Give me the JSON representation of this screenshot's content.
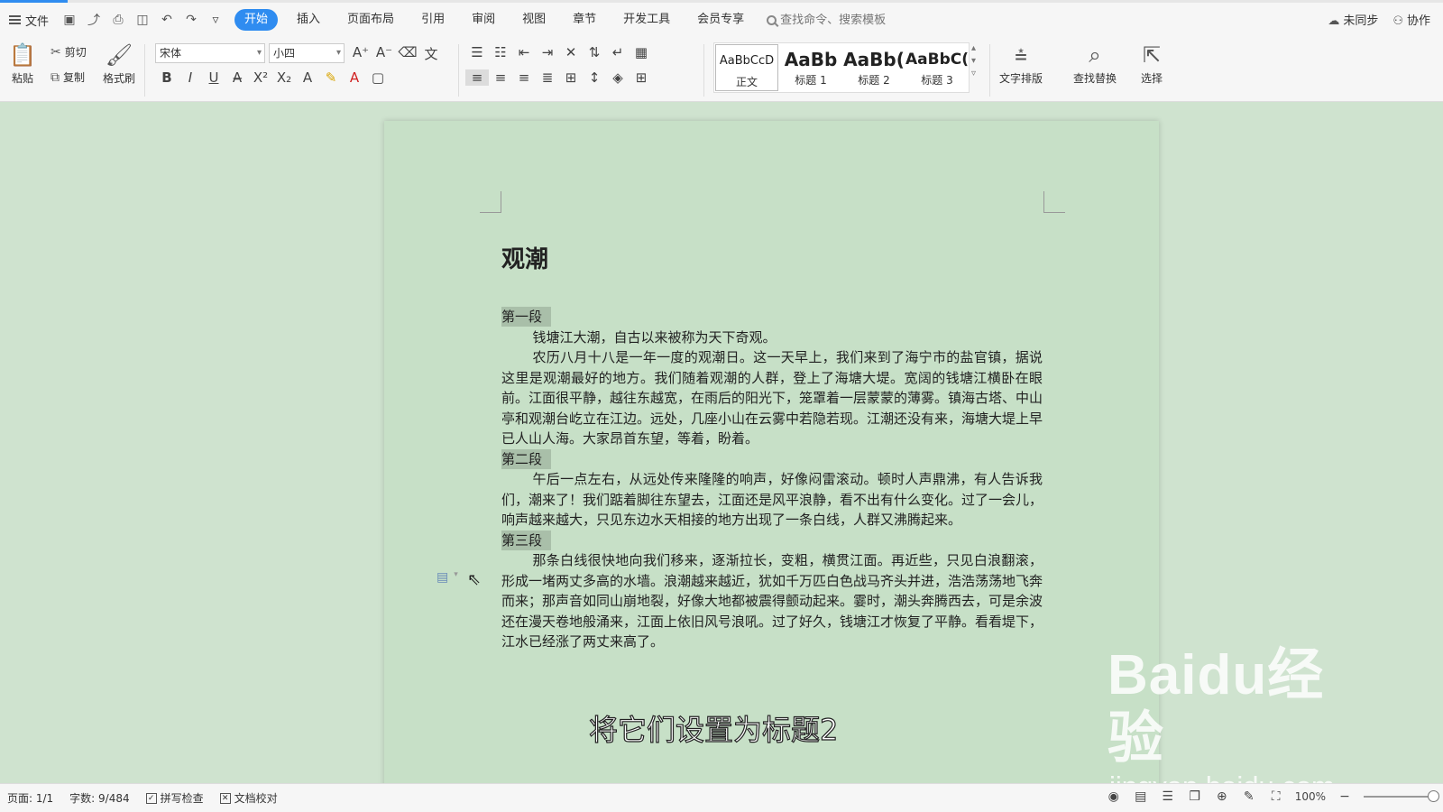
{
  "menubar": {
    "file_label": "文件",
    "tabs": [
      "开始",
      "插入",
      "页面布局",
      "引用",
      "审阅",
      "视图",
      "章节",
      "开发工具",
      "会员专享"
    ],
    "active_tab": "开始",
    "search_placeholder": "查找命令、搜索模板",
    "sync_label": "未同步",
    "collab_label": "协作"
  },
  "ribbon": {
    "paste": "粘贴",
    "cut": "剪切",
    "copy": "复制",
    "format_painter": "格式刷",
    "font_name": "宋体",
    "font_size": "小四",
    "styles": [
      {
        "preview": "AaBbCcD",
        "label": "正文"
      },
      {
        "preview": "AaBb",
        "label": "标题 1"
      },
      {
        "preview": "AaBb(",
        "label": "标题 2"
      },
      {
        "preview": "AaBbC(",
        "label": "标题 3"
      }
    ],
    "text_layout": "文字排版",
    "find_replace": "查找替换",
    "select": "选择"
  },
  "document": {
    "title": "观潮",
    "sections": [
      {
        "heading": "第一段",
        "paragraphs": [
          "钱塘江大潮，自古以来被称为天下奇观。",
          "农历八月十八是一年一度的观潮日。这一天早上，我们来到了海宁市的盐官镇，据说这里是观潮最好的地方。我们随着观潮的人群，登上了海塘大堤。宽阔的钱塘江横卧在眼前。江面很平静，越往东越宽，在雨后的阳光下，笼罩着一层蒙蒙的薄雾。镇海古塔、中山亭和观潮台屹立在江边。远处，几座小山在云雾中若隐若现。江潮还没有来，海塘大堤上早已人山人海。大家昂首东望，等着，盼着。"
        ]
      },
      {
        "heading": "第二段",
        "paragraphs": [
          "午后一点左右，从远处传来隆隆的响声，好像闷雷滚动。顿时人声鼎沸，有人告诉我们，潮来了！我们踮着脚往东望去，江面还是风平浪静，看不出有什么变化。过了一会儿，响声越来越大，只见东边水天相接的地方出现了一条白线，人群又沸腾起来。"
        ]
      },
      {
        "heading": "第三段",
        "paragraphs": [
          "那条白线很快地向我们移来，逐渐拉长，变粗，横贯江面。再近些，只见白浪翻滚，形成一堵两丈多高的水墙。浪潮越来越近，犹如千万匹白色战马齐头并进，浩浩荡荡地飞奔而来；那声音如同山崩地裂，好像大地都被震得颤动起来。霎时，潮头奔腾西去，可是余波还在漫天卷地般涌来，江面上依旧风号浪吼。过了好久，钱塘江才恢复了平静。看看堤下，江水已经涨了两丈来高了。"
        ]
      }
    ]
  },
  "overlay": {
    "subtitle": "将它们设置为标题2",
    "watermark_brand": "Baidu经验",
    "watermark_url": "jingyan.baidu.com"
  },
  "statusbar": {
    "page": "页面: 1/1",
    "word_count": "字数: 9/484",
    "spell_check": "拼写检查",
    "doc_proof": "文档校对",
    "zoom": "100%"
  }
}
